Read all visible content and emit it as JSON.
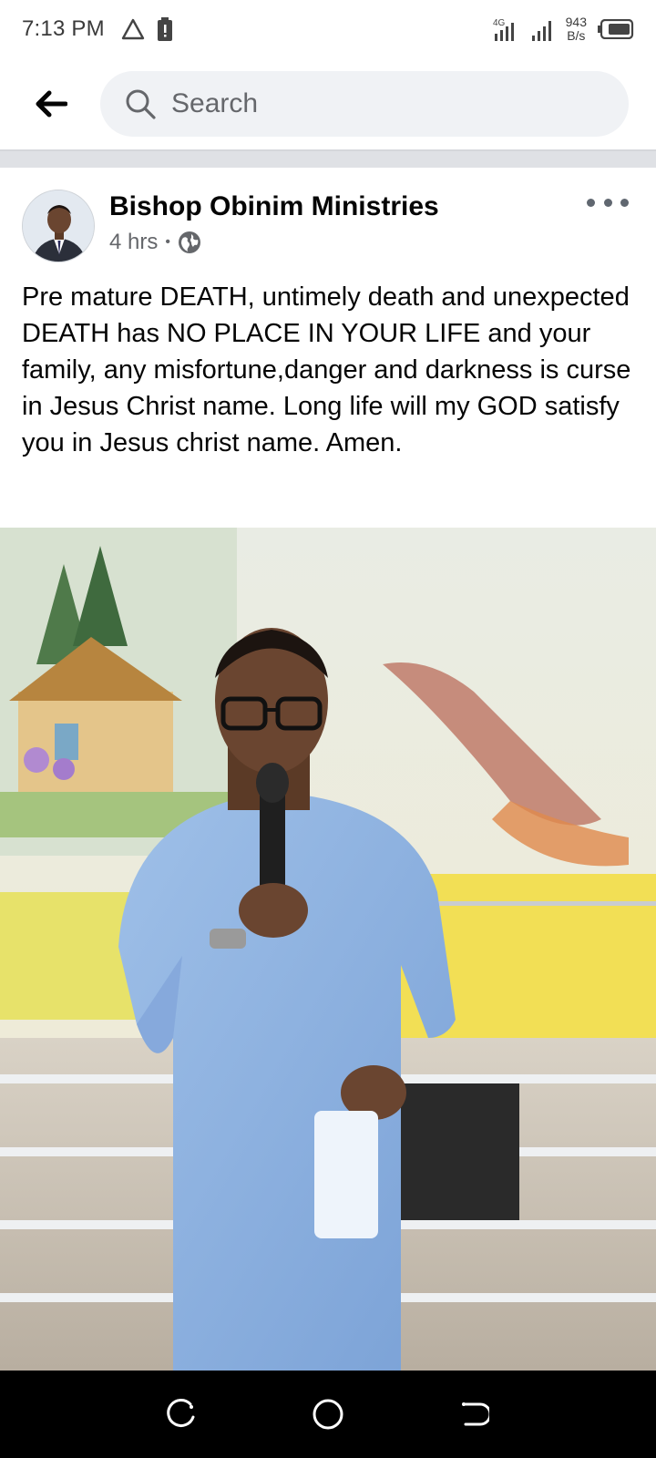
{
  "status_bar": {
    "time": "7:13 PM",
    "network_type": "4G",
    "speed_value": "943",
    "speed_unit": "B/s"
  },
  "header": {
    "back_icon": "arrow-left-icon",
    "search_placeholder": "Search"
  },
  "post": {
    "author": "Bishop Obinim Ministries",
    "time_ago": "4 hrs",
    "separator": "•",
    "audience_icon": "globe-icon",
    "more_icon": "ellipsis-icon",
    "text": "Pre mature DEATH, untimely death and unexpected DEATH has NO PLACE IN YOUR LIFE and your family, any misfortune,danger and darkness is curse in Jesus Christ name. Long life will my GOD satisfy you in Jesus christ name. Amen."
  },
  "nav_bar": {
    "recents_icon": "recents-icon",
    "home_icon": "home-circle-icon",
    "back_icon": "back-icon"
  },
  "colors": {
    "text_primary": "#050505",
    "text_secondary": "#65676b",
    "search_bg": "#f0f2f5",
    "divider": "#dfe1e5"
  }
}
